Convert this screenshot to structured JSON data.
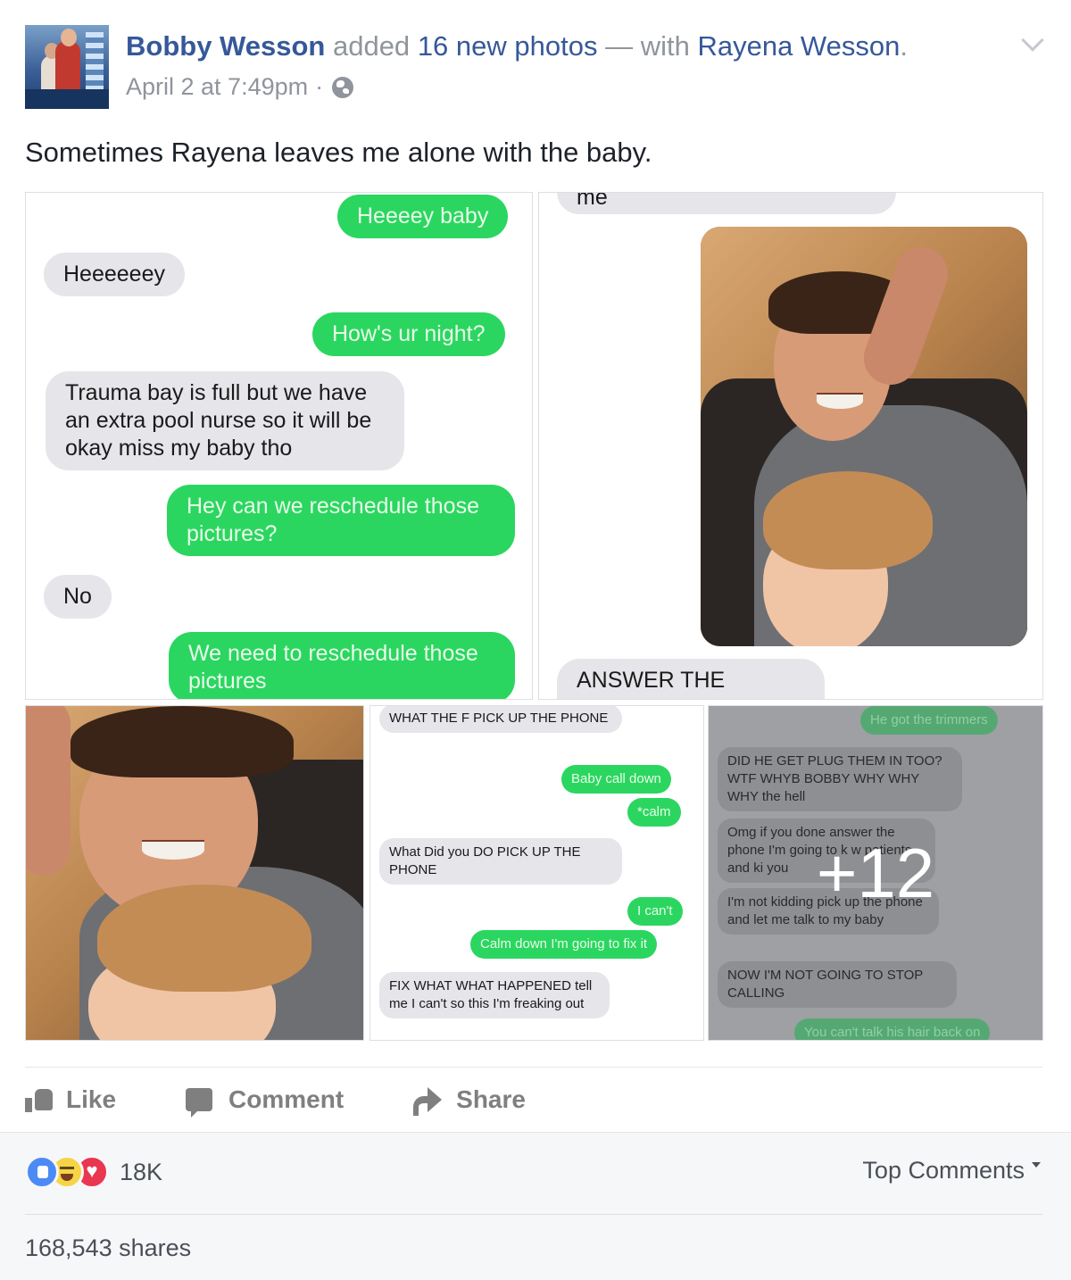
{
  "post": {
    "author": "Bobby Wesson",
    "action_text": "added",
    "photos_link": "16 new photos",
    "with_text": "— with",
    "tagged": "Rayena Wesson",
    "period": ".",
    "timestamp": "April 2 at 7:49pm",
    "separator": "·",
    "message": "Sometimes Rayena leaves me alone with the baby."
  },
  "photo1": {
    "messages": [
      {
        "dir": "out",
        "text": "Heeeey baby"
      },
      {
        "dir": "in",
        "text": "Heeeeeey"
      },
      {
        "dir": "out",
        "text": "How's ur night?"
      },
      {
        "dir": "in",
        "text": "Trauma bay is full but we have an extra pool nurse so it will be okay miss my baby tho"
      },
      {
        "dir": "out",
        "text": "Hey can we reschedule those pictures?"
      },
      {
        "dir": "in",
        "text": "No"
      },
      {
        "dir": "out",
        "text": "We need to reschedule those pictures"
      }
    ]
  },
  "photo2": {
    "top_fragment": "me",
    "caption": "ANSWER THE PHONE"
  },
  "photo4": {
    "messages": [
      {
        "dir": "in",
        "text": "WHAT THE F PICK UP THE PHONE"
      },
      {
        "dir": "out",
        "text": "Baby call down"
      },
      {
        "dir": "out",
        "text": "*calm"
      },
      {
        "dir": "in",
        "text": "What Did you DO PICK UP THE PHONE"
      },
      {
        "dir": "out",
        "text": "I can't"
      },
      {
        "dir": "out",
        "text": "Calm down I'm going to fix it"
      },
      {
        "dir": "in",
        "text": "FIX WHAT WHAT HAPPENED tell me I can't so this I'm freaking out"
      }
    ]
  },
  "photo5": {
    "messages": [
      {
        "dir": "out",
        "text": "He got the trimmers"
      },
      {
        "dir": "in",
        "text": "DID HE GET PLUG THEM IN TOO? WTF WHYB BOBBY WHY WHY WHY the hell"
      },
      {
        "dir": "in",
        "text": "Omg if you done answer the phone I'm going to k w patients and ki you"
      },
      {
        "dir": "in",
        "text": "I'm not kidding pick up the phone and let me talk to my baby"
      },
      {
        "dir": "in",
        "text": "NOW I'M NOT GOING TO STOP CALLING"
      },
      {
        "dir": "out",
        "text": "You can't talk his hair back on"
      }
    ],
    "more_count": "+12"
  },
  "actions": {
    "like": "Like",
    "comment": "Comment",
    "share": "Share"
  },
  "stats": {
    "reaction_count": "18K",
    "sort_label": "Top Comments",
    "shares": "168,543 shares"
  },
  "colors": {
    "link": "#365899",
    "imessage_green": "#2bd660",
    "imessage_gray": "#e5e5ea",
    "meta_gray": "#90949c"
  },
  "icons": [
    "globe-icon",
    "chevron-down-icon",
    "like-icon",
    "comment-icon",
    "share-icon",
    "like-reaction-icon",
    "haha-reaction-icon",
    "love-reaction-icon",
    "caret-down-icon"
  ]
}
